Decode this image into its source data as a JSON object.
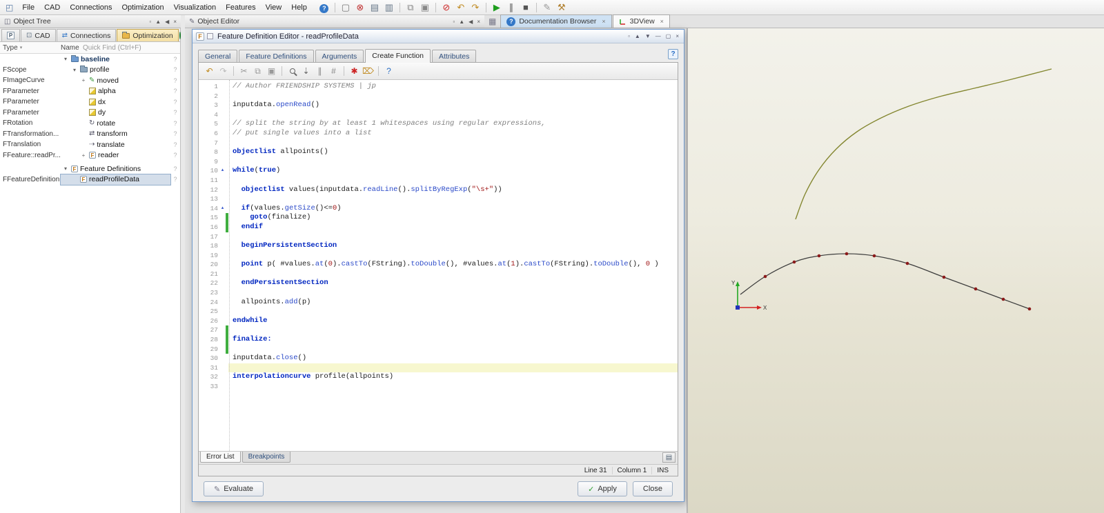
{
  "colors": {
    "curve_olive": "#83862f",
    "curve_dark": "#3c3c3c",
    "point_red": "#8b1a1a",
    "axis_x": "#d42222",
    "axis_y": "#22a822",
    "origin_blue": "#2233bb"
  },
  "glyphs": {
    "app_icon": "◰",
    "panel_tree_icon": "◫",
    "panel_editor_icon": "✎",
    "grid_icon": "▦",
    "sort_indicator": "▾",
    "header_buttons": [
      "▫",
      "▲",
      "◀",
      "×"
    ],
    "dialog_window_buttons": [
      "▫",
      "▲",
      "▼",
      "—",
      "▢",
      "×"
    ],
    "tab_close": "×",
    "row_help": "?"
  },
  "menubar": {
    "menus": [
      "File",
      "CAD",
      "Connections",
      "Optimization",
      "Visualization",
      "Features",
      "View",
      "Help"
    ],
    "toolbar": [
      {
        "name": "help-circle-icon",
        "glyph": "?",
        "color": "#ffffff",
        "badge": true
      },
      {
        "sep": true
      },
      {
        "name": "new-window-icon",
        "glyph": "▢",
        "color": "#777777"
      },
      {
        "name": "abort-icon",
        "glyph": "⊗",
        "color": "#c03030"
      },
      {
        "name": "save-icon",
        "glyph": "▤",
        "color": "#667788"
      },
      {
        "name": "save-all-icon",
        "glyph": "▥",
        "color": "#667788"
      },
      {
        "sep": true
      },
      {
        "name": "copy-icon",
        "glyph": "⧉",
        "color": "#888888"
      },
      {
        "name": "paste-icon",
        "glyph": "▣",
        "color": "#888888"
      },
      {
        "sep": true
      },
      {
        "name": "no-entry-icon",
        "glyph": "⊘",
        "color": "#cc2222"
      },
      {
        "name": "undo-icon",
        "glyph": "↶",
        "color": "#c08a20"
      },
      {
        "name": "redo-icon",
        "glyph": "↷",
        "color": "#c08a20"
      },
      {
        "sep": true
      },
      {
        "name": "run-icon",
        "glyph": "▶",
        "color": "#1e9e1e"
      },
      {
        "name": "pause-icon",
        "glyph": "∥",
        "color": "#555555"
      },
      {
        "name": "stop-icon",
        "glyph": "■",
        "color": "#555555"
      },
      {
        "sep": true
      },
      {
        "name": "edit-icon",
        "glyph": "✎",
        "color": "#999999"
      },
      {
        "name": "tool-icon",
        "glyph": "⚒",
        "color": "#b08030"
      }
    ]
  },
  "object_tree": {
    "title": "Object Tree",
    "tabs": [
      {
        "label": "",
        "icon": "project-icon"
      },
      {
        "label": "CAD",
        "icon": "monitor-icon"
      },
      {
        "label": "Connections",
        "icon": "connections-icon"
      },
      {
        "label": "Optimization",
        "icon": "folder-amber-icon",
        "active": true
      }
    ],
    "columns": {
      "type": "Type",
      "name": "Name"
    },
    "quick_find": "Quick Find (Ctrl+F)",
    "rows": [
      {
        "type": "",
        "name": "baseline",
        "icon": "folder-blue",
        "level": 0,
        "expander": "open",
        "bold": true
      },
      {
        "type": "FScope",
        "name": "profile",
        "icon": "folder",
        "level": 1,
        "expander": "open"
      },
      {
        "type": "FImageCurve",
        "name": "moved",
        "icon": "pencil-green",
        "level": 2,
        "expander": "plus"
      },
      {
        "type": "FParameter",
        "name": "alpha",
        "icon": "param",
        "level": 2
      },
      {
        "type": "FParameter",
        "name": "dx",
        "icon": "param",
        "level": 2
      },
      {
        "type": "FParameter",
        "name": "dy",
        "icon": "param",
        "level": 2
      },
      {
        "type": "FRotation",
        "name": "rotate",
        "icon": "rotate",
        "level": 2
      },
      {
        "type": "FTransformation...",
        "name": "transform",
        "icon": "transform",
        "level": 2
      },
      {
        "type": "FTranslation",
        "name": "translate",
        "icon": "translate",
        "level": 2
      },
      {
        "type": "FFeature::readPr...",
        "name": "reader",
        "icon": "feature",
        "level": 2,
        "expander": "plus"
      },
      {
        "type": "",
        "name": "Feature Definitions",
        "icon": "feature",
        "level": 0,
        "expander": "open",
        "gap_before": true
      },
      {
        "type": "FFeatureDefinition",
        "name": "readProfileData",
        "icon": "feature",
        "level": 1,
        "selected": true
      }
    ]
  },
  "object_editor": {
    "title": "Object Editor"
  },
  "right_tabs": [
    {
      "label": "Documentation Browser",
      "icon": "help-circle-icon",
      "tint": true
    },
    {
      "label": "3DView",
      "icon": "axes-icon",
      "active": true
    }
  ],
  "dialog": {
    "title": "Feature Definition Editor - readProfileData",
    "title_icon_letter": "F",
    "tabs": [
      "General",
      "Feature Definitions",
      "Arguments",
      "Create Function",
      "Attributes"
    ],
    "active_tab_index": 3,
    "help_label": "?",
    "toolbar": [
      {
        "name": "undo-icon",
        "glyph": "↶",
        "color": "#c08a20"
      },
      {
        "name": "redo-icon",
        "glyph": "↷",
        "color": "#bbbbbb"
      },
      {
        "sep": true
      },
      {
        "name": "cut-icon",
        "glyph": "✂",
        "color": "#999999"
      },
      {
        "name": "copy-icon",
        "glyph": "⧉",
        "color": "#999999"
      },
      {
        "name": "paste-icon",
        "glyph": "▣",
        "color": "#999999"
      },
      {
        "sep": true
      },
      {
        "name": "search-icon",
        "glyph": "mag",
        "color": "#666666"
      },
      {
        "name": "goto-line-icon",
        "glyph": "⇣",
        "color": "#666666"
      },
      {
        "name": "whitespace-icon",
        "glyph": "∥",
        "color": "#888888"
      },
      {
        "name": "comment-icon",
        "glyph": "#",
        "color": "#888888"
      },
      {
        "sep": true
      },
      {
        "name": "breakpoint-icon",
        "glyph": "✱",
        "color": "#cc2222"
      },
      {
        "name": "clean-icon",
        "glyph": "⌦",
        "color": "#c08a20"
      },
      {
        "sep": true
      },
      {
        "name": "help-icon",
        "glyph": "?",
        "color": "#2b6fc4"
      }
    ],
    "bottom_tabs": [
      {
        "label": "Error List",
        "active": true
      },
      {
        "label": "Breakpoints"
      }
    ],
    "panel_button_glyph": "▤",
    "status": {
      "line_label": "Line 31",
      "column_label": "Column 1",
      "mode": "INS"
    },
    "buttons": [
      {
        "label": "Evaluate",
        "icon": "✎",
        "align": "left"
      },
      {
        "label": "Apply",
        "icon": "✓",
        "icon_color": "#2e9e2e",
        "align": "right"
      },
      {
        "label": "Close",
        "align": "right"
      }
    ]
  },
  "code": {
    "current_line": 31,
    "fold_lines": [
      10,
      14
    ],
    "changed_lines": [
      15,
      16,
      27,
      28,
      29
    ],
    "lines": [
      {
        "n": 1,
        "tokens": [
          {
            "c": "cm",
            "t": "// Author FRIENDSHIP SYSTEMS | jp"
          }
        ]
      },
      {
        "n": 2,
        "tokens": []
      },
      {
        "n": 3,
        "tokens": [
          {
            "c": "pl",
            "t": "inputdata."
          },
          {
            "c": "kw",
            "t": "openRead"
          },
          {
            "c": "pl",
            "t": "()"
          }
        ]
      },
      {
        "n": 4,
        "tokens": []
      },
      {
        "n": 5,
        "tokens": [
          {
            "c": "cm",
            "t": "// split the string by at least 1 whitespaces using regular expressions,"
          }
        ]
      },
      {
        "n": 6,
        "tokens": [
          {
            "c": "cm",
            "t": "// put single values into a list"
          }
        ]
      },
      {
        "n": 7,
        "tokens": []
      },
      {
        "n": 8,
        "tokens": [
          {
            "c": "kb",
            "t": "objectlist"
          },
          {
            "c": "pl",
            "t": " allpoints()"
          }
        ]
      },
      {
        "n": 9,
        "tokens": []
      },
      {
        "n": 10,
        "tokens": [
          {
            "c": "kb",
            "t": "while"
          },
          {
            "c": "pl",
            "t": "("
          },
          {
            "c": "kb",
            "t": "true"
          },
          {
            "c": "pl",
            "t": ")"
          }
        ]
      },
      {
        "n": 11,
        "tokens": []
      },
      {
        "n": 12,
        "tokens": [
          {
            "c": "pl",
            "t": "  "
          },
          {
            "c": "kb",
            "t": "objectlist"
          },
          {
            "c": "pl",
            "t": " values(inputdata."
          },
          {
            "c": "kw",
            "t": "readLine"
          },
          {
            "c": "pl",
            "t": "()."
          },
          {
            "c": "kw",
            "t": "splitByRegExp"
          },
          {
            "c": "pl",
            "t": "("
          },
          {
            "c": "st",
            "t": "\"\\s+\""
          },
          {
            "c": "pl",
            "t": "))"
          }
        ]
      },
      {
        "n": 13,
        "tokens": []
      },
      {
        "n": 14,
        "tokens": [
          {
            "c": "pl",
            "t": "  "
          },
          {
            "c": "kb",
            "t": "if"
          },
          {
            "c": "pl",
            "t": "(values."
          },
          {
            "c": "kw",
            "t": "getSize"
          },
          {
            "c": "pl",
            "t": "()<="
          },
          {
            "c": "nu",
            "t": "0"
          },
          {
            "c": "pl",
            "t": ")"
          }
        ]
      },
      {
        "n": 15,
        "tokens": [
          {
            "c": "pl",
            "t": "    "
          },
          {
            "c": "kb",
            "t": "goto"
          },
          {
            "c": "pl",
            "t": "(finalize)"
          }
        ]
      },
      {
        "n": 16,
        "tokens": [
          {
            "c": "pl",
            "t": "  "
          },
          {
            "c": "kb",
            "t": "endif"
          }
        ]
      },
      {
        "n": 17,
        "tokens": []
      },
      {
        "n": 18,
        "tokens": [
          {
            "c": "pl",
            "t": "  "
          },
          {
            "c": "kb",
            "t": "beginPersistentSection"
          }
        ]
      },
      {
        "n": 19,
        "tokens": []
      },
      {
        "n": 20,
        "tokens": [
          {
            "c": "pl",
            "t": "  "
          },
          {
            "c": "kb",
            "t": "point"
          },
          {
            "c": "pl",
            "t": " p( #values."
          },
          {
            "c": "kw",
            "t": "at"
          },
          {
            "c": "pl",
            "t": "("
          },
          {
            "c": "nu",
            "t": "0"
          },
          {
            "c": "pl",
            "t": ")."
          },
          {
            "c": "kw",
            "t": "castTo"
          },
          {
            "c": "pl",
            "t": "(FString)."
          },
          {
            "c": "kw",
            "t": "toDouble"
          },
          {
            "c": "pl",
            "t": "(), #values."
          },
          {
            "c": "kw",
            "t": "at"
          },
          {
            "c": "pl",
            "t": "("
          },
          {
            "c": "nu",
            "t": "1"
          },
          {
            "c": "pl",
            "t": ")."
          },
          {
            "c": "kw",
            "t": "castTo"
          },
          {
            "c": "pl",
            "t": "(FString)."
          },
          {
            "c": "kw",
            "t": "toDouble"
          },
          {
            "c": "pl",
            "t": "(), "
          },
          {
            "c": "nu",
            "t": "0"
          },
          {
            "c": "pl",
            "t": " )"
          }
        ]
      },
      {
        "n": 21,
        "tokens": []
      },
      {
        "n": 22,
        "tokens": [
          {
            "c": "pl",
            "t": "  "
          },
          {
            "c": "kb",
            "t": "endPersistentSection"
          }
        ]
      },
      {
        "n": 23,
        "tokens": []
      },
      {
        "n": 24,
        "tokens": [
          {
            "c": "pl",
            "t": "  allpoints."
          },
          {
            "c": "kw",
            "t": "add"
          },
          {
            "c": "pl",
            "t": "(p)"
          }
        ]
      },
      {
        "n": 25,
        "tokens": []
      },
      {
        "n": 26,
        "tokens": [
          {
            "c": "kb",
            "t": "endwhile"
          }
        ]
      },
      {
        "n": 27,
        "tokens": []
      },
      {
        "n": 28,
        "tokens": [
          {
            "c": "kb",
            "t": "finalize:"
          }
        ]
      },
      {
        "n": 29,
        "tokens": []
      },
      {
        "n": 30,
        "tokens": [
          {
            "c": "pl",
            "t": "inputdata."
          },
          {
            "c": "kw",
            "t": "close"
          },
          {
            "c": "pl",
            "t": "()"
          }
        ]
      },
      {
        "n": 31,
        "tokens": []
      },
      {
        "n": 32,
        "tokens": [
          {
            "c": "kb",
            "t": "interpolationcurve"
          },
          {
            "c": "pl",
            "t": " profile(allpoints)"
          }
        ]
      },
      {
        "n": 33,
        "tokens": []
      }
    ]
  },
  "viewport": {
    "axis": {
      "x_label": "X",
      "y_label": "Y"
    },
    "origin": [
      72,
      405
    ],
    "olive_curve": [
      [
        156,
        277
      ],
      [
        170,
        240
      ],
      [
        190,
        205
      ],
      [
        215,
        175
      ],
      [
        245,
        150
      ],
      [
        280,
        130
      ],
      [
        320,
        113
      ],
      [
        365,
        99
      ],
      [
        415,
        87
      ],
      [
        465,
        75
      ],
      [
        527,
        59
      ]
    ],
    "profile_curve": [
      [
        76,
        386
      ],
      [
        112,
        360
      ],
      [
        154,
        339
      ],
      [
        190,
        330
      ],
      [
        230,
        327
      ],
      [
        270,
        330
      ],
      [
        318,
        341
      ],
      [
        371,
        361
      ],
      [
        417,
        378
      ],
      [
        457,
        393
      ],
      [
        495,
        407
      ]
    ]
  }
}
